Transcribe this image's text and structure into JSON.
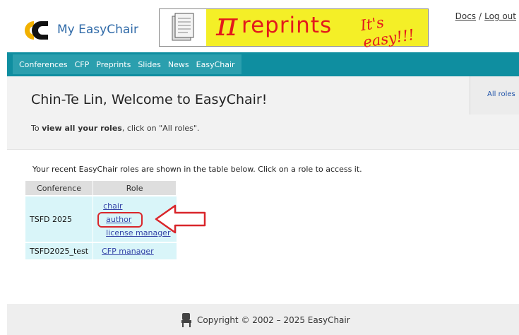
{
  "header": {
    "logo_text": "My EasyChair",
    "banner": {
      "pi": "π",
      "brand": "reprints",
      "tag": "It's easy!!!"
    },
    "links": {
      "docs": "Docs",
      "separator": "/",
      "logout": "Log out"
    }
  },
  "nav": {
    "items": [
      "Conferences",
      "CFP",
      "Preprints",
      "Slides",
      "News",
      "EasyChair"
    ]
  },
  "welcome": {
    "title": "Chin-Te Lin, Welcome to EasyChair!",
    "hint_prefix": "To ",
    "hint_bold": "view all your roles",
    "hint_suffix": ", click on \"All roles\".",
    "all_roles_tab": "All roles"
  },
  "main": {
    "intro": "Your recent EasyChair roles are shown in the table below. Click on a role to access it.",
    "table": {
      "headers": [
        "Conference",
        "Role"
      ],
      "rows": [
        {
          "conference": "TSFD 2025",
          "roles": [
            "chair",
            "author",
            "license manager"
          ]
        },
        {
          "conference": "TSFD2025_test",
          "roles": [
            "CFP manager"
          ]
        }
      ]
    },
    "annotation_color": "#d9262b"
  },
  "footer": {
    "copyright": "Copyright © 2002 – 2025 EasyChair"
  },
  "colors": {
    "nav_bg": "#0f8ea0",
    "nav_active_bg": "#2b9fae",
    "link": "#3645a8",
    "table_cell": "#d9f5f9",
    "banner_yellow": "#f4ef27",
    "banner_red": "#e3191c"
  }
}
